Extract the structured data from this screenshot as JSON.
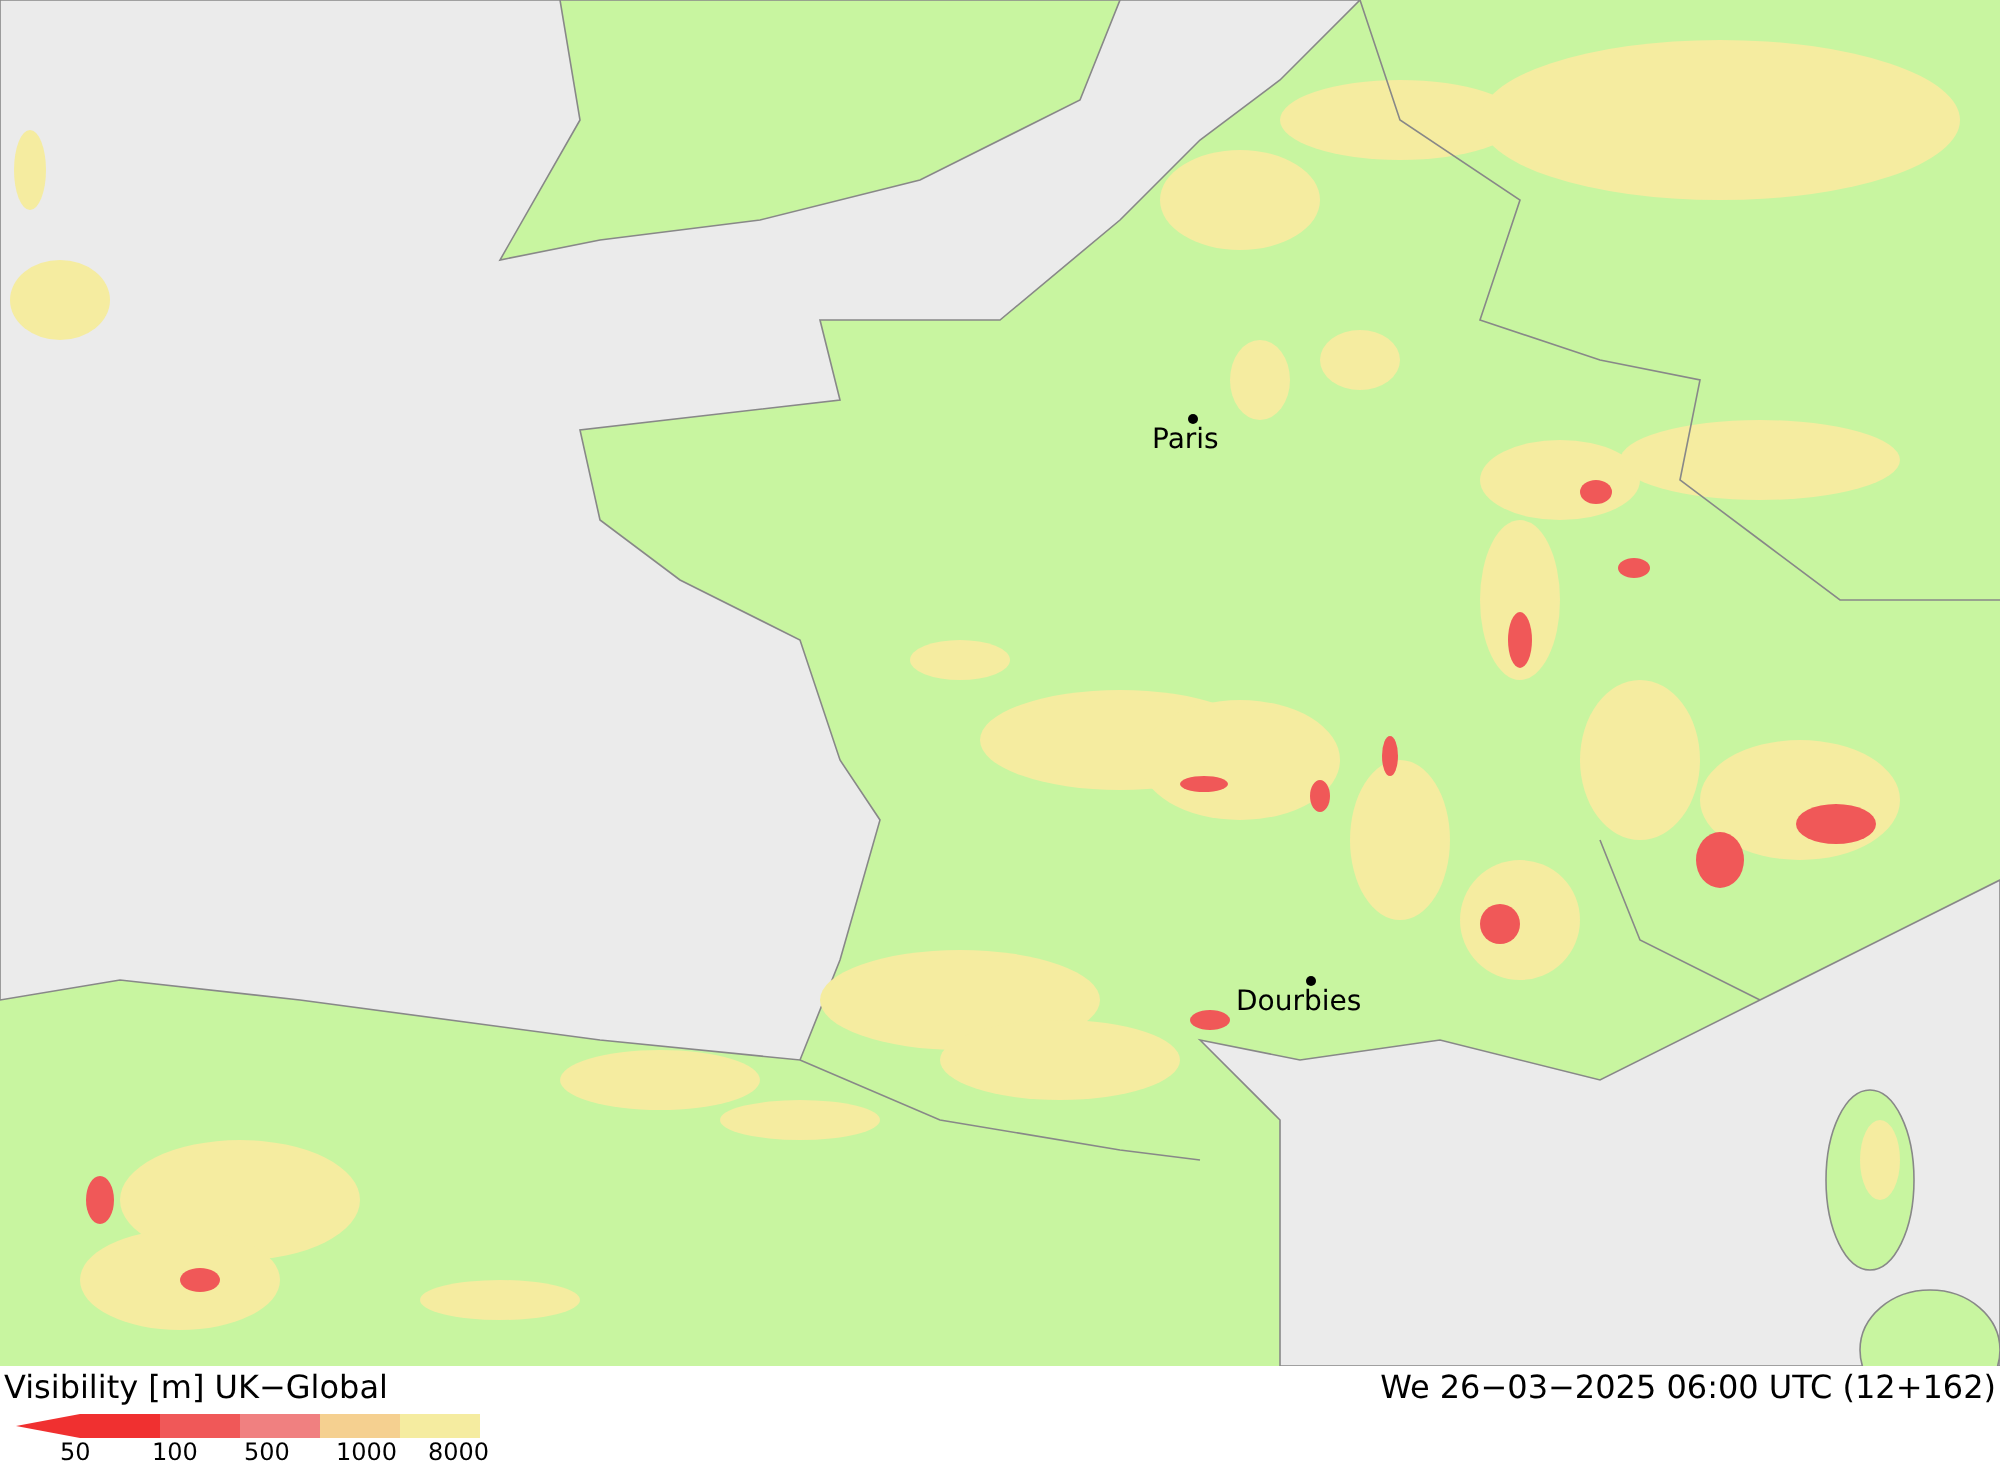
{
  "map": {
    "places": [
      {
        "name": "Paris"
      },
      {
        "name": "Dourbies"
      }
    ]
  },
  "footer": {
    "title": "Visibility [m] UK−Global",
    "timestamp": "We 26−03−2025 06:00 UTC (12+162)",
    "legend": [
      {
        "label": "50",
        "color": "#f03030"
      },
      {
        "label": "100",
        "color": "#f05858"
      },
      {
        "label": "500",
        "color": "#f08080"
      },
      {
        "label": "1000",
        "color": "#f5d090"
      },
      {
        "label": "8000",
        "color": "#f5eca0"
      }
    ]
  }
}
